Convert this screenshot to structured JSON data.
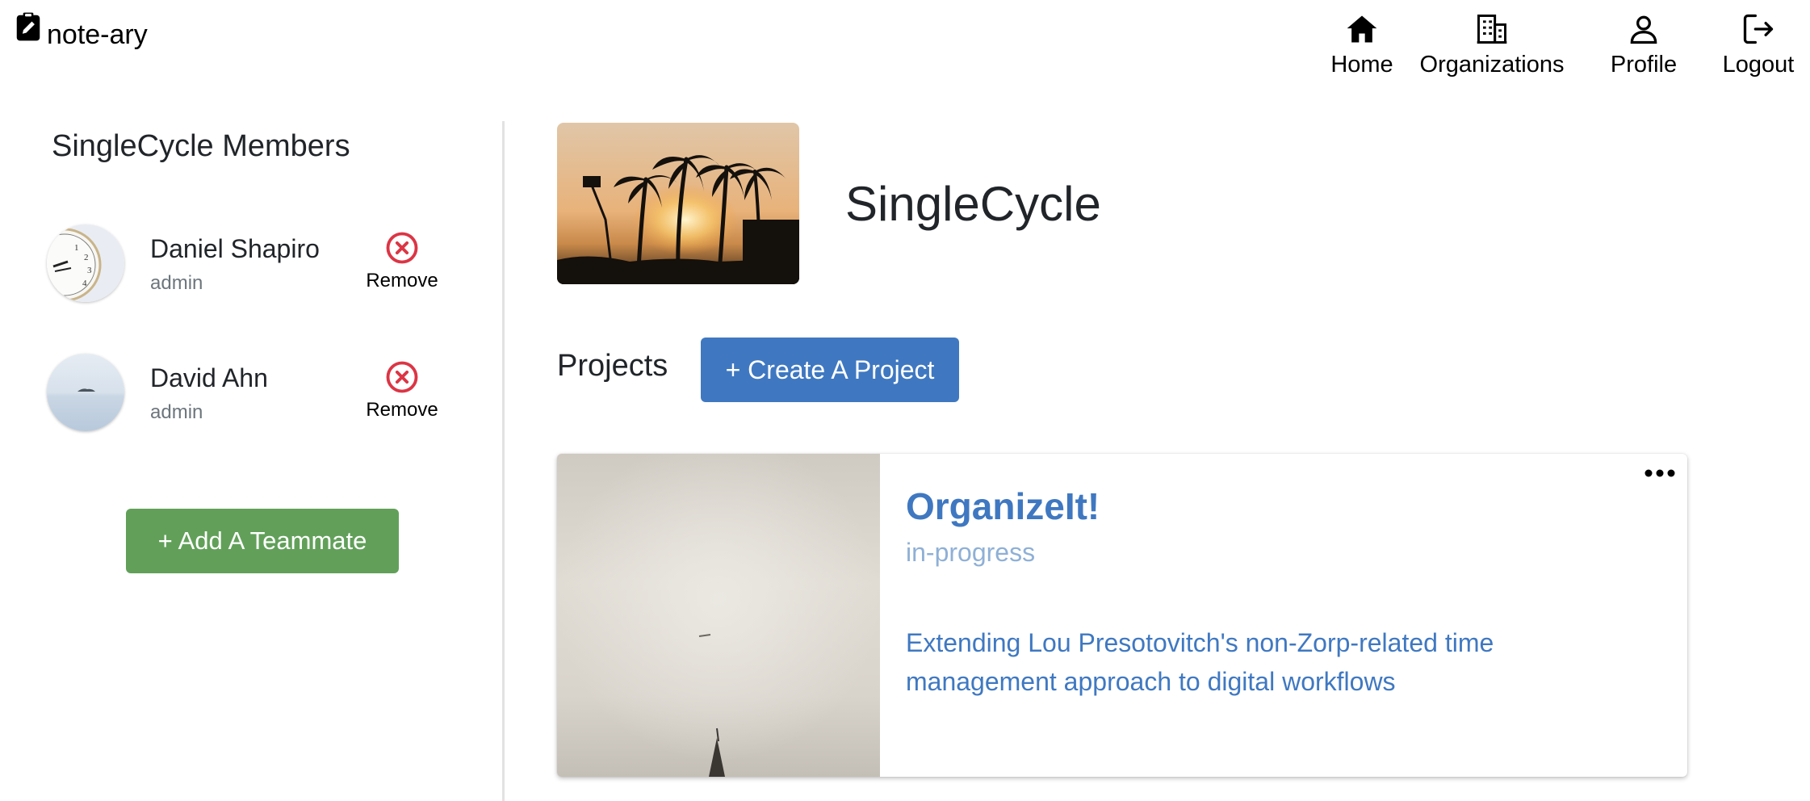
{
  "app": {
    "name": "note-ary"
  },
  "nav": {
    "items": [
      {
        "label": "Home",
        "icon": "home-icon"
      },
      {
        "label": "Organizations",
        "icon": "building-icon"
      },
      {
        "label": "Profile",
        "icon": "person-icon"
      },
      {
        "label": "Logout",
        "icon": "logout-icon"
      }
    ]
  },
  "sidebar": {
    "title": "SingleCycle Members",
    "members": [
      {
        "name": "Daniel Shapiro",
        "role": "admin",
        "remove_label": "Remove",
        "avatar": "clock-photo"
      },
      {
        "name": "David Ahn",
        "role": "admin",
        "remove_label": "Remove",
        "avatar": "sea-island-photo"
      }
    ],
    "add_button": "+ Add A Teammate"
  },
  "organization": {
    "name": "SingleCycle",
    "image": "palm-trees-sunset-photo"
  },
  "projects": {
    "label": "Projects",
    "create_button": "+ Create A Project",
    "items": [
      {
        "title": "OrganizeIt!",
        "status": "in-progress",
        "description": "Extending Lou Presotovitch's non-Zorp-related time management approach to digital workflows",
        "image": "cloudy-sky-steeple-photo"
      }
    ]
  },
  "colors": {
    "primary": "#3f78c1",
    "success": "#62a05a",
    "danger": "#dc3545",
    "status_muted": "#8fb0d6"
  }
}
